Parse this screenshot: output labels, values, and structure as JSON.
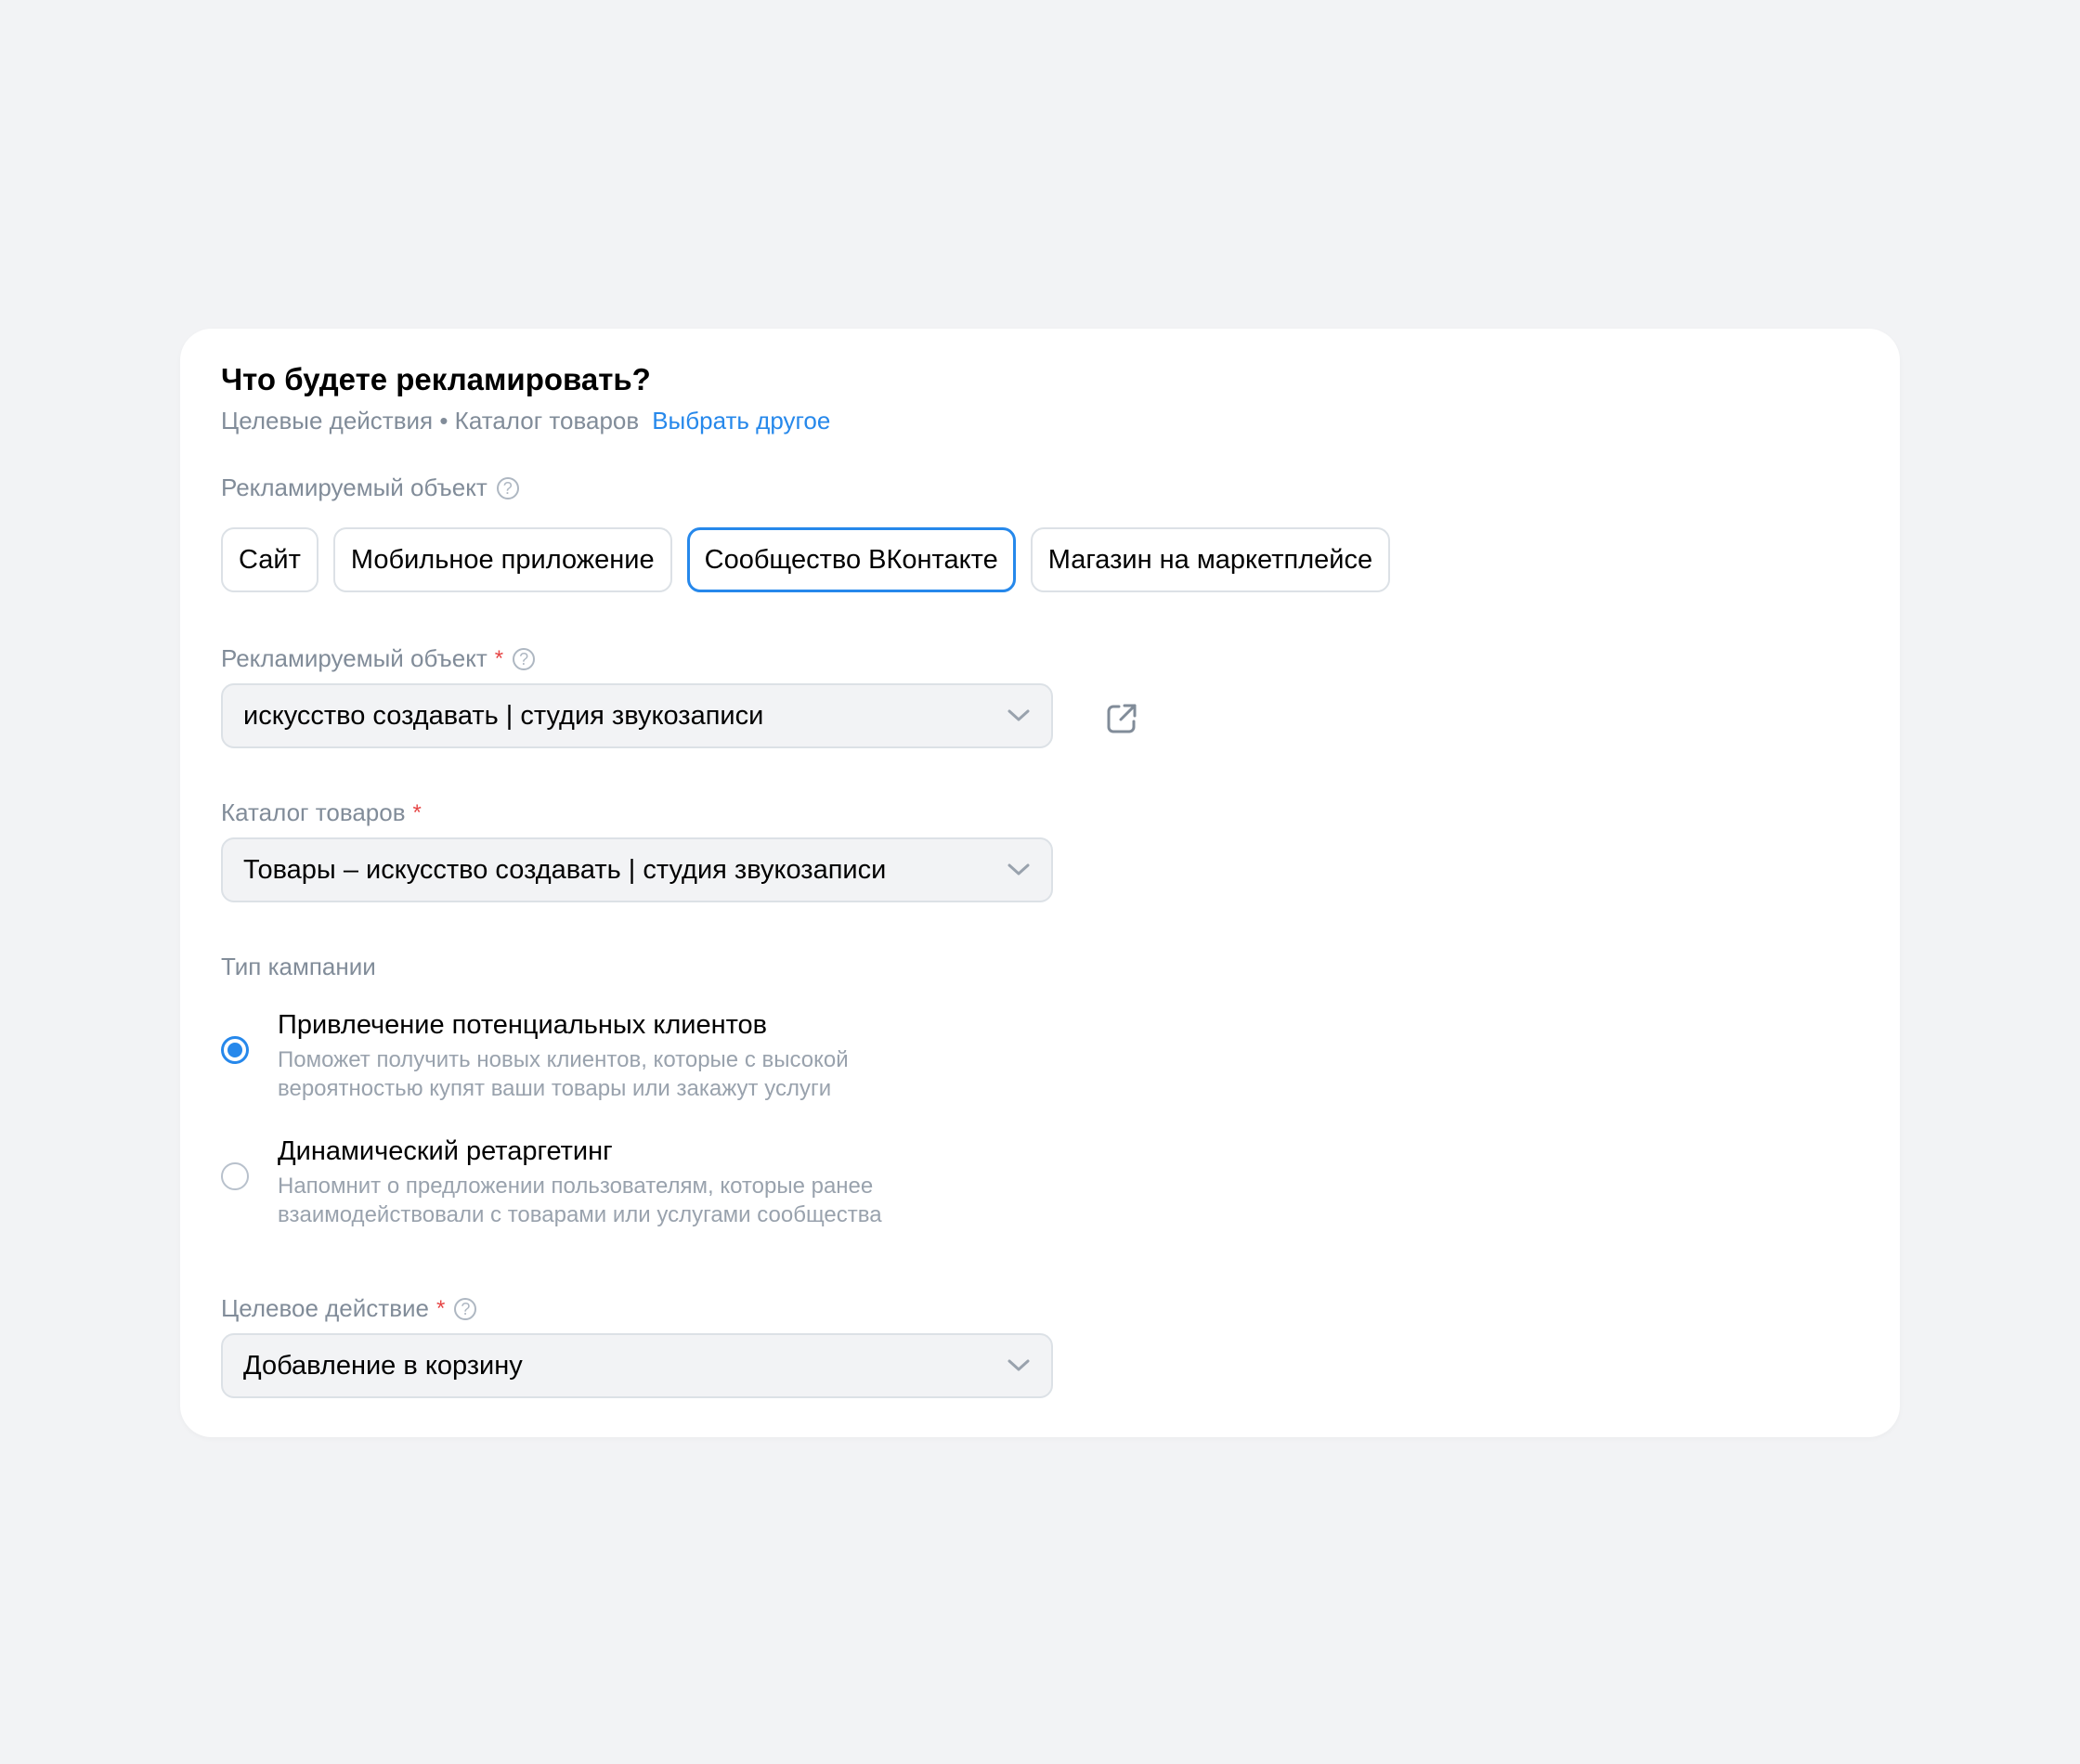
{
  "header": {
    "title": "Что будете рекламировать?",
    "subtitle": "Целевые действия • Каталог товаров",
    "change_link": "Выбрать другое"
  },
  "object_type": {
    "label": "Рекламируемый объект",
    "options": [
      "Сайт",
      "Мобильное приложение",
      "Сообщество ВКонтакте",
      "Магазин на маркетплейсе"
    ],
    "selected": "Сообщество ВКонтакте"
  },
  "object": {
    "label": "Рекламируемый объект",
    "required_mark": "*",
    "value": "искусство создавать | студия звукозаписи"
  },
  "catalog": {
    "label": "Каталог товаров",
    "required_mark": "*",
    "value": "Товары – искусство создавать | студия звукозаписи"
  },
  "campaign_type": {
    "label": "Тип кампании",
    "options": [
      {
        "title": "Привлечение потенциальных клиентов",
        "description": "Поможет получить новых клиентов, которые с высокой вероятностью купят ваши товары или закажут услуги",
        "checked": true
      },
      {
        "title": "Динамический ретаргетинг",
        "description": "Напомнит о предложении пользователям, которые ранее взаимодействовали с товарами или услугами сообщества",
        "checked": false
      }
    ]
  },
  "target_action": {
    "label": "Целевое действие",
    "required_mark": "*",
    "value": "Добавление в корзину"
  },
  "icons": {
    "help": "question-circle-icon",
    "dropdown": "chevron-down-icon",
    "external": "external-link-icon"
  },
  "colors": {
    "accent": "#2688eb",
    "required": "#e64646",
    "secondary_text": "#818c99",
    "background": "#f2f3f5"
  }
}
